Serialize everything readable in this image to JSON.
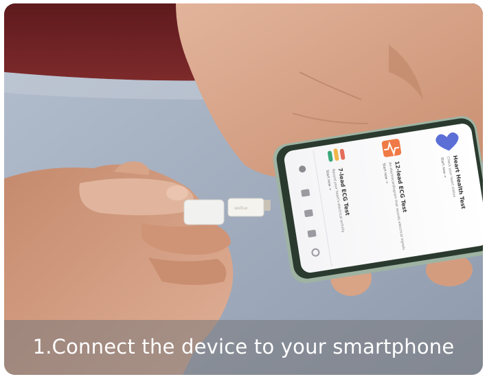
{
  "caption": "1.Connect the device to your smartphone",
  "phone_screen": {
    "items": [
      {
        "label": "12-lead ECG Test",
        "sub": "An electrocardiogram that records electrical signals",
        "link": "Start now →",
        "icon": "ecg-icon"
      },
      {
        "label": "7-lead ECG Test",
        "sub": "Record your heart's electrical activity",
        "link": "Start now →",
        "icon": "leads-icon"
      },
      {
        "label": "Heart Health Test",
        "sub": "Check your heart status",
        "link": "Start now →",
        "icon": "heart-icon"
      }
    ]
  },
  "colors": {
    "background_top": "#6b1f22",
    "bedsheet": "#aab6c8",
    "skin": "#d39a7c",
    "phone_body": "#2b3a2e",
    "caption_bar": "#7a7a7e",
    "caption_text": "#ffffff"
  }
}
